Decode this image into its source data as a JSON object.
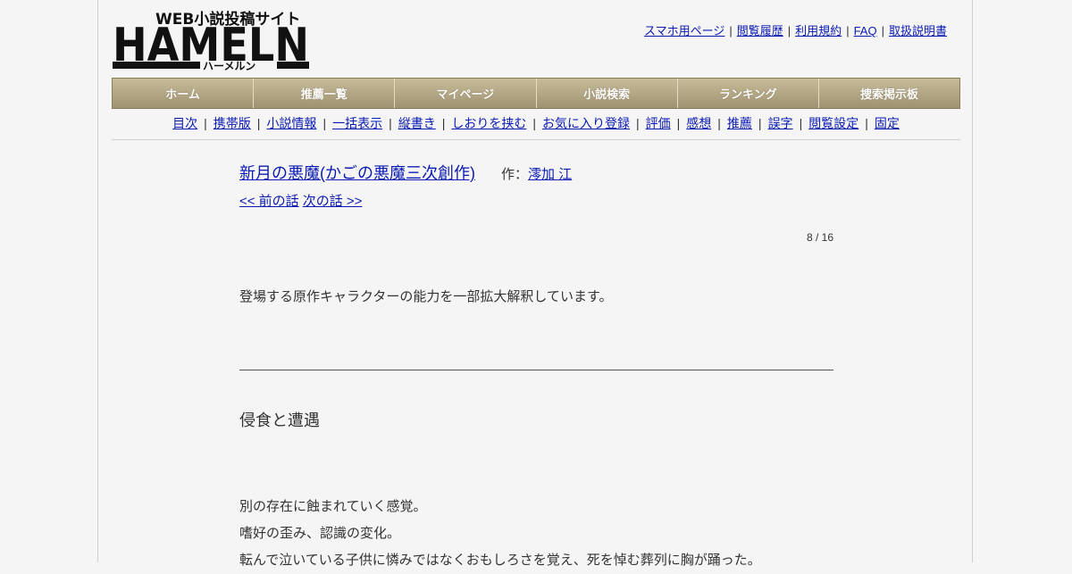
{
  "site": {
    "logo_text": "HAMELN",
    "logo_tagline": "WEB小説投稿サイト",
    "logo_kana": "ハーメルン"
  },
  "top_links": [
    "スマホ用ページ",
    "閲覧履歴",
    "利用規約",
    "FAQ",
    "取扱説明書"
  ],
  "main_nav": [
    "ホーム",
    "推薦一覧",
    "マイページ",
    "小説検索",
    "ランキング",
    "捜索掲示板"
  ],
  "sub_nav": [
    "目次",
    "携帯版",
    "小説情報",
    "一括表示",
    "縦書き",
    "しおりを挟む",
    "お気に入り登録",
    "評価",
    "感想",
    "推薦",
    "誤字",
    "閲覧設定",
    "固定"
  ],
  "novel": {
    "title": "新月の悪魔(かごの悪魔三次創作)",
    "author_label": "作：",
    "author_name": "澪加 江",
    "prev_label": "<< 前の話",
    "next_label": "次の話 >>",
    "page_count": "8 / 16",
    "preface": "登場する原作キャラクターの能力を一部拡大解釈しています。",
    "chapter_title": "侵食と遭遇",
    "body_lines": [
      "別の存在に蝕まれていく感覚。",
      "嗜好の歪み、認識の変化。",
      "転んで泣いている子供に憐みではなくおもしろさを覚え、死を悼む葬列に胸が踊った。"
    ]
  },
  "colors": {
    "link": "#0a1ab3",
    "nav_bg_top": "#c7bc99",
    "nav_bg_bottom": "#9f9272",
    "page_bg": "#f5f5f5"
  }
}
